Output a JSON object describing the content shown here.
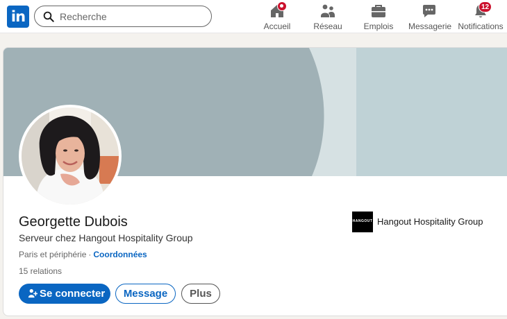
{
  "nav": {
    "logo_text": "in",
    "search_placeholder": "Recherche",
    "items": [
      {
        "label": "Accueil",
        "icon": "home-icon",
        "badge": "dot"
      },
      {
        "label": "Réseau",
        "icon": "network-icon"
      },
      {
        "label": "Emplois",
        "icon": "briefcase-icon"
      },
      {
        "label": "Messagerie",
        "icon": "messaging-icon"
      },
      {
        "label": "Notifications",
        "icon": "bell-icon",
        "badge": "12"
      }
    ]
  },
  "profile": {
    "name": "Georgette Dubois",
    "headline": "Serveur chez Hangout Hospitality Group",
    "location": "Paris et périphérie",
    "separator": "·",
    "contact_link": "Coordonnées",
    "relations": "15 relations",
    "actions": {
      "connect": "Se connecter",
      "message": "Message",
      "more": "Plus"
    },
    "company": {
      "name": "Hangout Hospitality Group",
      "logo_text": "HANGOUT"
    }
  },
  "colors": {
    "brand": "#0a66c2",
    "badge": "#cb112d",
    "banner_dark": "#a0b1b6",
    "banner_light": "#d6e1e3",
    "banner_mid": "#bfd2d6"
  }
}
